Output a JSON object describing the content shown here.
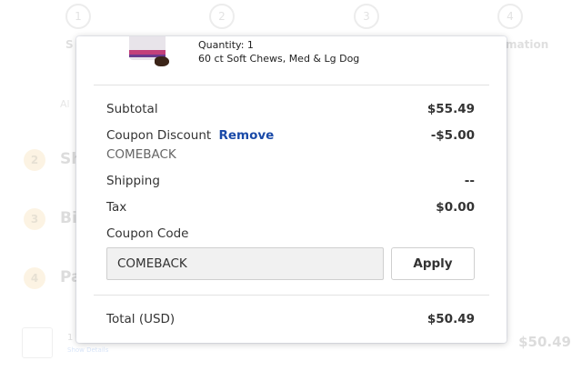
{
  "background": {
    "steps": [
      {
        "number": "1",
        "label": "S"
      },
      {
        "number": "2",
        "label": ""
      },
      {
        "number": "3",
        "label": ""
      },
      {
        "number": "4",
        "label": "mation"
      }
    ],
    "note": "Al",
    "sections": [
      {
        "number": "2",
        "label": "Sh"
      },
      {
        "number": "3",
        "label": "Bi"
      },
      {
        "number": "4",
        "label": "Pa"
      }
    ],
    "item_qty": "1",
    "show_details": "Show Details",
    "total": "$50.49"
  },
  "summary": {
    "product": {
      "quantity_label": "Quantity: 1",
      "name": "60 ct Soft Chews, Med & Lg Dog"
    },
    "subtotal_label": "Subtotal",
    "subtotal_value": "$55.49",
    "discount_label": "Coupon Discount",
    "remove_label": "Remove",
    "discount_value": "-$5.00",
    "applied_code": "COMEBACK",
    "shipping_label": "Shipping",
    "shipping_value": "--",
    "tax_label": "Tax",
    "tax_value": "$0.00",
    "coupon_code_label": "Coupon Code",
    "coupon_input_value": "COMEBACK",
    "apply_label": "Apply",
    "total_label": "Total (USD)",
    "total_value": "$50.49"
  },
  "colors": {
    "link": "#1a4aa8",
    "step_badge": "#f4c36b"
  }
}
